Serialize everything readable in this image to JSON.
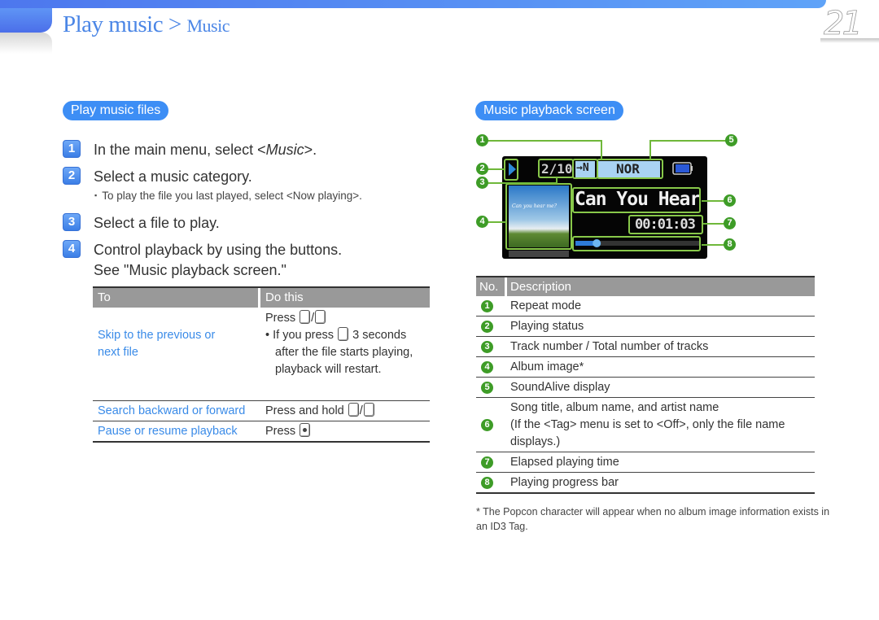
{
  "header": {
    "title": "Play music",
    "separator": ">",
    "subtitle": "Music",
    "page_number": "21"
  },
  "left": {
    "section_label": "Play music files",
    "steps": [
      {
        "num": "1",
        "text_before": "In the main menu, select <",
        "text_italic": "Music",
        "text_after": ">."
      },
      {
        "num": "2",
        "text": "Select a music category."
      },
      {
        "num": "3",
        "text": "Select a file to play."
      },
      {
        "num": "4",
        "text": "Control playback by using the buttons.",
        "text2": "See \"Music playback screen.\""
      }
    ],
    "note": "To play the file you last played, select <Now playing>.",
    "note_bullet": "▪",
    "table": {
      "headers": [
        "To",
        "Do this"
      ],
      "rows": [
        {
          "to_line1": "Skip to the previous or",
          "to_line2": "next file",
          "do_line1": "Press",
          "do_bullet": "•",
          "do_line2a": "If you press",
          "do_line2b": "3 seconds",
          "do_line3": "after the file starts playing,",
          "do_line4": "playback will restart."
        },
        {
          "to": "Search backward or forward",
          "do": "Press and hold"
        },
        {
          "to": "Pause or resume playback",
          "do": "Press"
        }
      ],
      "slash": "/"
    }
  },
  "right": {
    "section_label": "Music playback screen",
    "device": {
      "play_status_icon": "play-triangle",
      "track": "2/10",
      "repeat_mode": "→N",
      "soundalive": "NOR",
      "battery_icon": "battery-full",
      "album_text": "Can you hear me?",
      "song_title": "Can You Hear",
      "elapsed": "00:01:03",
      "progress": 0.17
    },
    "callouts": [
      "1",
      "2",
      "3",
      "4",
      "5",
      "6",
      "7",
      "8"
    ],
    "table": {
      "headers": [
        "No.",
        "Description"
      ],
      "rows": [
        {
          "num": "1",
          "desc": "Repeat mode"
        },
        {
          "num": "2",
          "desc": "Playing status"
        },
        {
          "num": "3",
          "desc": "Track number / Total number of tracks"
        },
        {
          "num": "4",
          "desc": "Album image*"
        },
        {
          "num": "5",
          "desc": "SoundAlive display"
        },
        {
          "num": "6",
          "desc": "Song title, album name, and artist name",
          "desc2": "(If the <Tag> menu is set to <Off>, only the file name",
          "desc3": "displays.)"
        },
        {
          "num": "7",
          "desc": "Elapsed playing time"
        },
        {
          "num": "8",
          "desc": "Playing progress bar"
        }
      ]
    },
    "footnote": "* The Popcon character will appear when no album image information exists in an ID3 Tag."
  },
  "colors": {
    "brand_blue": "#3d8ef5",
    "title_blue": "#4b86e6",
    "link_blue": "#3a8be8",
    "callout_green": "#3e9c27",
    "highlight_green": "#88c84a",
    "header_gray": "#999999"
  }
}
